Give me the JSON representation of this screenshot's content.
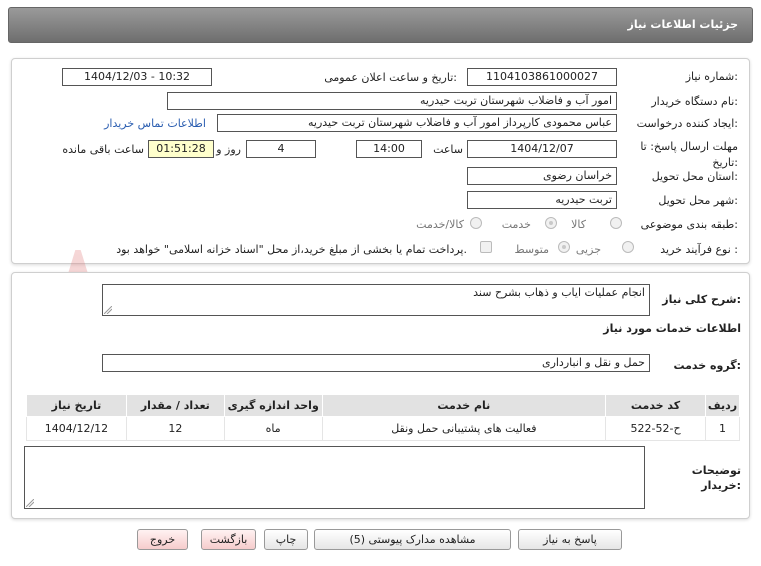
{
  "header": {
    "title": "جزئیات اطلاعات نیاز"
  },
  "form": {
    "need_number_label": "شماره نیاز:",
    "need_number": "1104103861000027",
    "announce_label": "تاریخ و ساعت اعلان عمومی:",
    "announce_value": "1404/12/03 - 10:32",
    "buyer_label": "نام دستگاه خریدار:",
    "buyer_value": "امور آب و فاضلاب شهرستان تربت حیدریه",
    "creator_label": "ایجاد کننده درخواست:",
    "creator_value": "عباس محمودی کارپرداز امور آب و فاضلاب شهرستان تربت حیدریه",
    "contact_link": "اطلاعات تماس خریدار",
    "deadline_label": "مهلت ارسال پاسخ: تا تاریخ:",
    "deadline_date": "1404/12/07",
    "time_label": "ساعت",
    "deadline_time": "14:00",
    "days_value": "4",
    "days_label": "روز و",
    "remaining_time": "01:51:28",
    "remaining_label": "ساعت باقی مانده",
    "province_label": "استان محل تحویل:",
    "province_value": "خراسان رضوی",
    "city_label": "شهر محل تحویل:",
    "city_value": "تربت حیدریه",
    "category_label": "طبقه بندی موضوعی:",
    "category_options": [
      "کالا",
      "خدمت",
      "کالا/خدمت"
    ],
    "category_selected": "خدمت",
    "process_label": "نوع فرآیند خرید :",
    "process_options": [
      "جزیی",
      "متوسط"
    ],
    "process_selected": "متوسط",
    "payment_note": "پرداخت تمام یا بخشی از مبلغ خرید،از محل \"اسناد خزانه اسلامی\" خواهد بود."
  },
  "summary": {
    "label": "شرح کلی نیاز:",
    "value": "انجام عملیات ایاب و ذهاب بشرح سند"
  },
  "services": {
    "section_title": "اطلاعات خدمات مورد نیاز",
    "group_label": "گروه خدمت:",
    "group_value": "حمل و نقل و انبارداری",
    "table": {
      "columns": [
        "ردیف",
        "کد خدمت",
        "نام خدمت",
        "واحد اندازه گیری",
        "تعداد / مقدار",
        "تاریخ نیاز"
      ],
      "rows": [
        [
          "1",
          "ح-52-522",
          "فعالیت های پشتیبانی حمل ونقل",
          "ماه",
          "12",
          "1404/12/12"
        ]
      ]
    },
    "buyer_notes_label": "توضیحات خریدار:",
    "buyer_notes_value": ""
  },
  "watermark": {
    "text": "AriaTender.neT"
  },
  "buttons": {
    "reply": "پاسخ به نیاز",
    "attachments": "مشاهده مدارک پیوستی (5)",
    "print": "چاپ",
    "back": "بازگشت",
    "exit": "خروج"
  },
  "colors": {
    "header": "#7d7d7d",
    "highlight": "#ffffcc",
    "pink_button": "#f6cccc",
    "watermark": "#e07a7a"
  }
}
